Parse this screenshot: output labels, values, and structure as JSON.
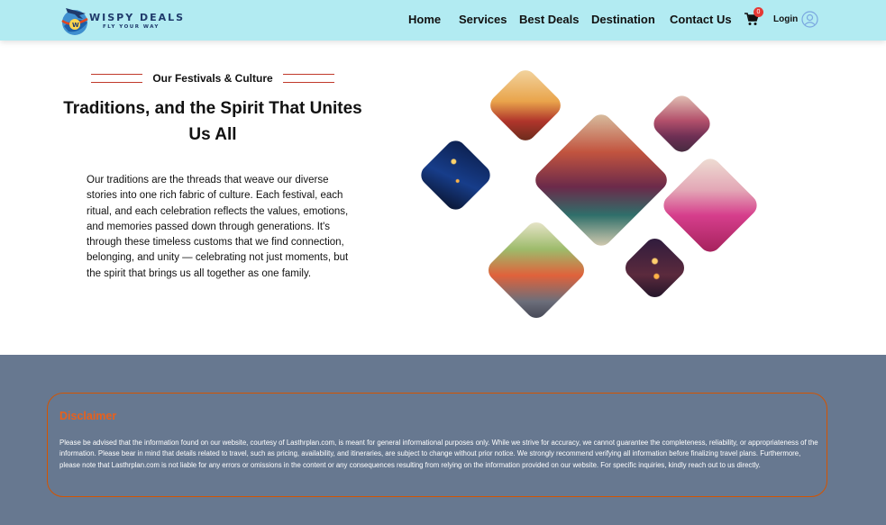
{
  "brand": {
    "name": "WISPY DEALS",
    "tagline": "FLY YOUR WAY"
  },
  "nav": {
    "links": [
      "Home",
      "Services",
      "Best Deals",
      "Destination",
      "Contact Us"
    ],
    "cart_count": "0",
    "login_label": "Login"
  },
  "hero": {
    "eyebrow": "Our Festivals & Culture",
    "title": "Traditions, and the Spirit That Unites Us All",
    "body": "Our traditions are the threads that weave our diverse stories into one rich fabric of culture. Each festival, each ritual, and each celebration reflects the values, emotions, and memories passed down through generations. It's through these timeless customs that we find connection, belonging, and unity — celebrating not just moments, but the spirit that brings us all together as one family."
  },
  "gallery": {
    "tiles": [
      "rajasthani-dancers",
      "ganges-night-lamps",
      "folk-dancers-center",
      "desert-musicians",
      "pink-saree-procession",
      "painted-elephant",
      "sky-lanterns"
    ]
  },
  "disclaimer": {
    "title": "Disclaimer",
    "text": "Please be advised that the information found on our website, courtesy of Lasthrplan.com, is meant for general informational purposes only. While we strive for accuracy, we cannot guarantee the completeness, reliability, or appropriateness of the information. Please bear in mind that details related to travel, such as pricing, availability, and itineraries, are subject to change without prior notice. We strongly recommend verifying all information before finalizing travel plans. Furthermore, please note that Lasthrplan.com is not liable for any errors or omissions in the content or any consequences resulting from relying on the information provided on our website. For specific inquiries, kindly reach out to us directly."
  },
  "colors": {
    "navbar_bg": "#b2ebf2",
    "accent_red": "#c0392b",
    "footer_bg": "#677890",
    "disclaimer_orange": "#e8601c"
  }
}
